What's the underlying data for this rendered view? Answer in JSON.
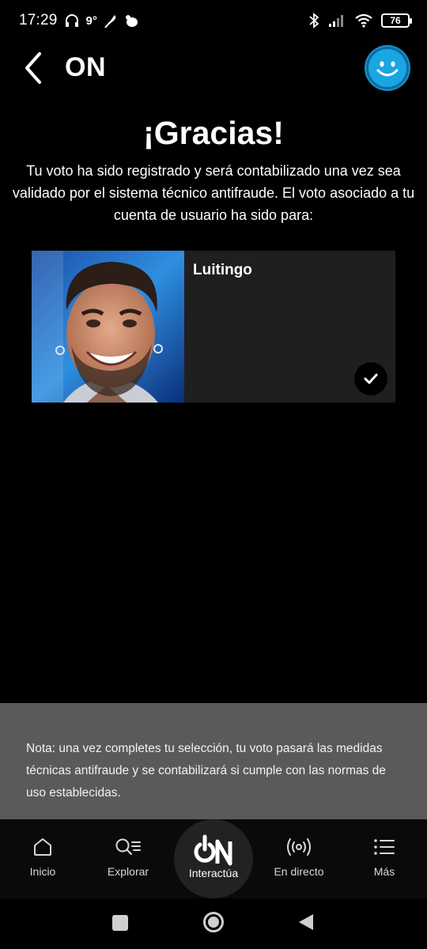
{
  "status_bar": {
    "time": "17:29",
    "temperature": "9°",
    "battery": "76"
  },
  "header": {
    "title": "ON"
  },
  "confirmation": {
    "title": "¡Gracias!",
    "message": "Tu voto ha sido registrado y será contabilizado una vez sea validado por el sistema técnico antifraude. El voto asociado a tu cuenta de usuario ha sido para:"
  },
  "candidate": {
    "name": "Luitingo",
    "selected": true
  },
  "note": {
    "text": "Nota: una vez completes tu selección, tu voto pasará las medidas técnicas antifraude y se contabilizará si cumple con las normas de uso establecidas."
  },
  "bottom_nav": {
    "items": [
      {
        "label": "Inicio",
        "icon": "home-icon"
      },
      {
        "label": "Explorar",
        "icon": "search-list-icon"
      },
      {
        "label": "Interactúa",
        "icon": "on-power-logo",
        "logo_text": "ON"
      },
      {
        "label": "En directo",
        "icon": "broadcast-icon"
      },
      {
        "label": "Más",
        "icon": "menu-icon"
      }
    ]
  },
  "colors": {
    "background": "#000000",
    "accent_blue": "#1aa5e3",
    "card_background": "#1f1f1f",
    "note_background": "#5a5a5a"
  }
}
